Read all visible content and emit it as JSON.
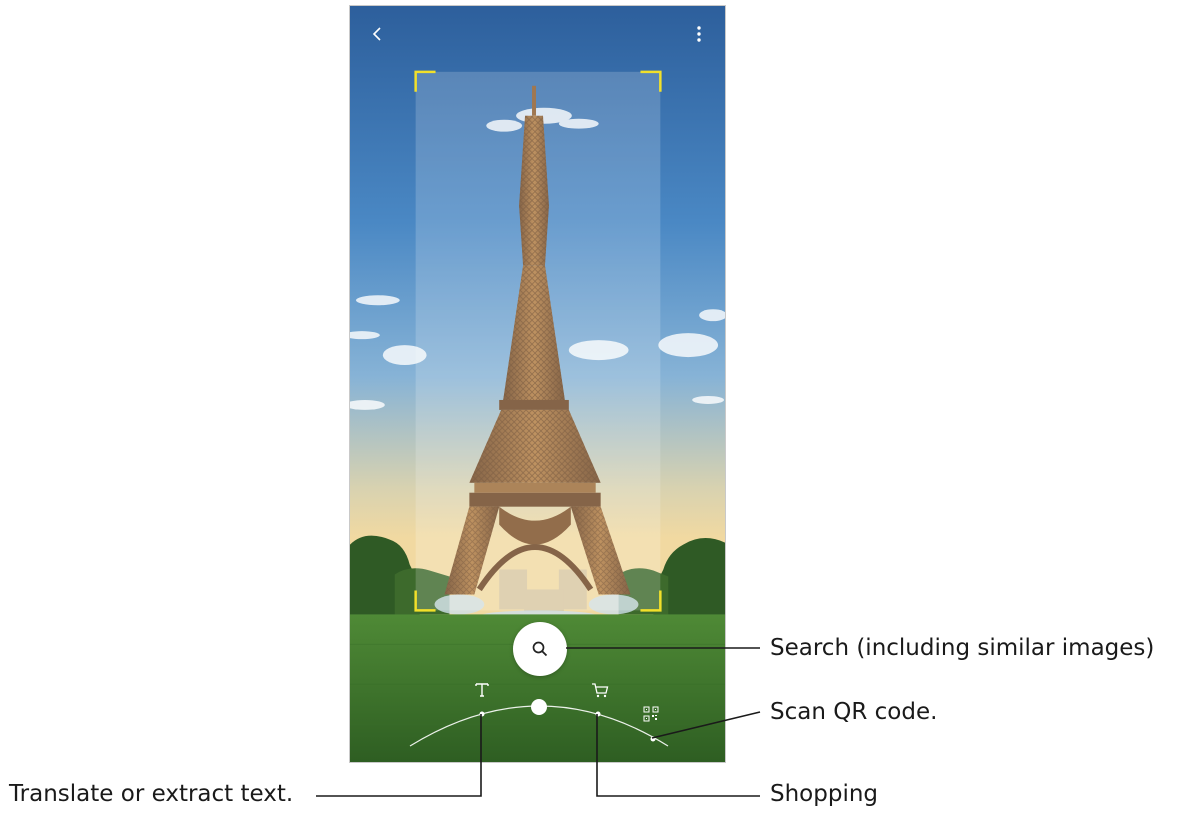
{
  "screen": {
    "back_icon": "chevron-left-icon",
    "more_icon": "kebab-menu-icon",
    "search_icon": "magnifier-icon",
    "modes": [
      {
        "id": "text",
        "icon": "text-T-icon"
      },
      {
        "id": "shopping",
        "icon": "shopping-cart-icon"
      },
      {
        "id": "qr",
        "icon": "qr-code-icon"
      }
    ],
    "viewfinder_color": "#f2e02a"
  },
  "callouts": {
    "search": "Search (including similar images)",
    "qr": "Scan QR code.",
    "shopping": "Shopping",
    "translate": "Translate or extract text."
  },
  "colors": {
    "sky_top": "#2f6aa8",
    "sky_bottom": "#f0d6a2",
    "grass": "#3f7a2c",
    "tower": "#8b5a2b",
    "line": "#1a1a1a"
  }
}
